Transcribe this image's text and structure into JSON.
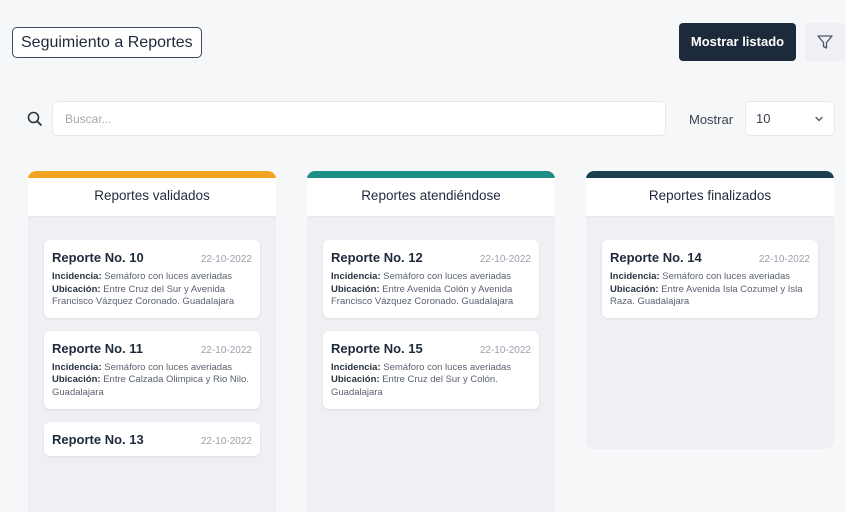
{
  "header": {
    "title": "Seguimiento a Reportes",
    "show_list_label": "Mostrar listado",
    "filter_icon": "filter-icon"
  },
  "search": {
    "placeholder": "Buscar...",
    "value": ""
  },
  "pagination": {
    "show_label": "Mostrar",
    "show_value": "10"
  },
  "columns": [
    {
      "title": "Reportes validados",
      "accent": "#f3a423",
      "cards": [
        {
          "title": "Reporte No. 10",
          "date": "22-10-2022",
          "incidencia_label": "Incidencia:",
          "incidencia": "Semáforo con luces averiadas",
          "ubicacion_label": "Ubicación:",
          "ubicacion": "Entre Cruz del Sur y Avenida Francisco Vázquez Coronado. Guadalajara"
        },
        {
          "title": "Reporte No. 11",
          "date": "22-10-2022",
          "incidencia_label": "Incidencia:",
          "incidencia": "Semáforo con luces averiadas",
          "ubicacion_label": "Ubicación:",
          "ubicacion": "Entre Calzada Olimpica y Rio Nilo. Guadalajara"
        },
        {
          "title": "Reporte No. 13",
          "date": "22-10-2022"
        }
      ]
    },
    {
      "title": "Reportes atendiéndose",
      "accent": "#1e8f86",
      "cards": [
        {
          "title": "Reporte No. 12",
          "date": "22-10-2022",
          "incidencia_label": "Incidencia:",
          "incidencia": "Semáforo con luces averiadas",
          "ubicacion_label": "Ubicación:",
          "ubicacion": "Entre Avenida Colón y Avenida Francisco Vázquez Coronado. Guadalajara"
        },
        {
          "title": "Reporte No. 15",
          "date": "22-10-2022",
          "incidencia_label": "Incidencia:",
          "incidencia": "Semáforo con luces averiadas",
          "ubicacion_label": "Ubicación:",
          "ubicacion": "Entre Cruz del Sur y Colón. Guadalajara"
        }
      ]
    },
    {
      "title": "Reportes finalizados",
      "accent": "#1b4150",
      "cards": [
        {
          "title": "Reporte No. 14",
          "date": "22-10-2022",
          "incidencia_label": "Incidencia:",
          "incidencia": "Semáforo con luces averiadas",
          "ubicacion_label": "Ubicación:",
          "ubicacion": "Entre Avenida Isla Cozumel y Isla Raza. Guadalajara"
        }
      ]
    }
  ]
}
